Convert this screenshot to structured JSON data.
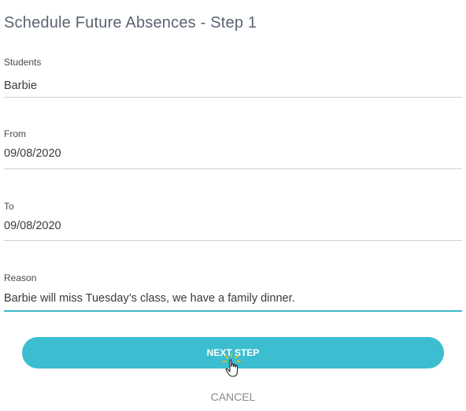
{
  "title": "Schedule Future Absences - Step 1",
  "fields": {
    "students": {
      "label": "Students",
      "value": "Barbie"
    },
    "from": {
      "label": "From",
      "value": "09/08/2020"
    },
    "to": {
      "label": "To",
      "value": "09/08/2020"
    },
    "reason": {
      "label": "Reason",
      "value": "Barbie will miss Tuesday’s class, we have a family dinner."
    }
  },
  "actions": {
    "next_label": "NEXT STEP",
    "cancel_label": "CANCEL"
  },
  "colors": {
    "accent": "#3cbdd0",
    "title": "#5a6472",
    "divider": "#cfcfcf"
  },
  "cursor_icon": "hand-pointer-icon"
}
